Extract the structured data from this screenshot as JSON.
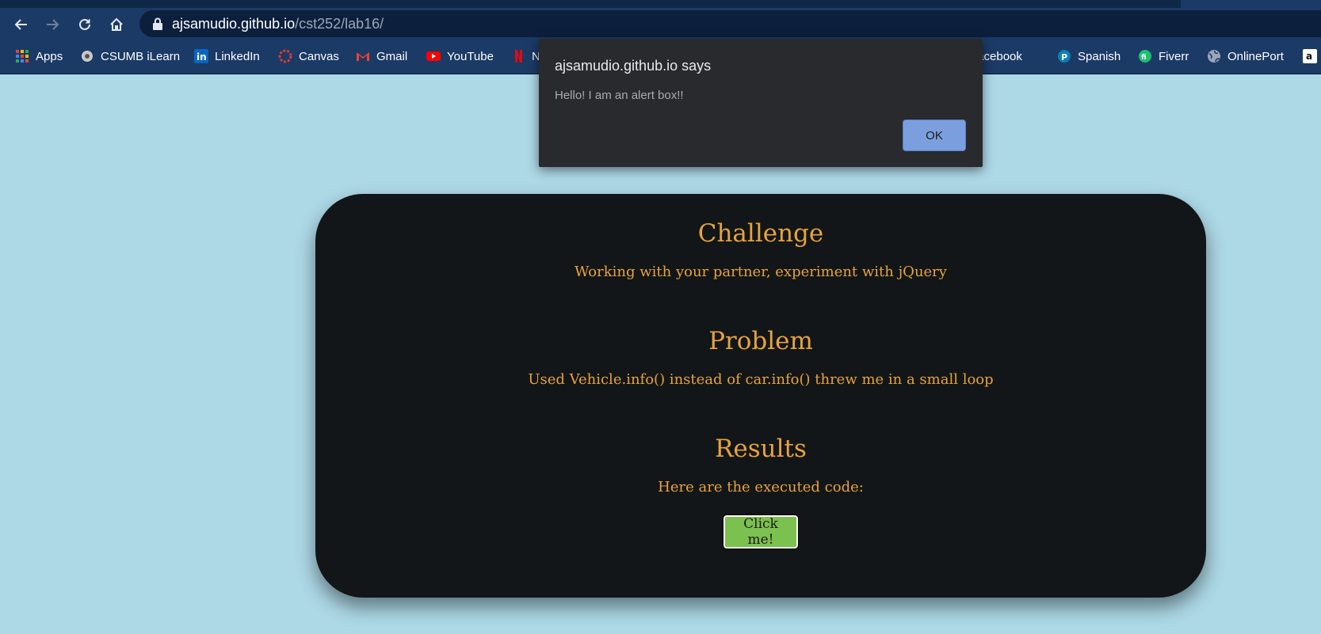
{
  "browser": {
    "url_host": "ajsamudio.github.io",
    "url_path": "/cst252/lab16/",
    "bookmarks": [
      {
        "label": "Apps",
        "icon": "apps-grid-icon"
      },
      {
        "label": "CSUMB iLearn",
        "icon": "ilearn-icon"
      },
      {
        "label": "LinkedIn",
        "icon": "linkedin-icon"
      },
      {
        "label": "Canvas",
        "icon": "canvas-icon"
      },
      {
        "label": "Gmail",
        "icon": "gmail-icon"
      },
      {
        "label": "YouTube",
        "icon": "youtube-icon"
      },
      {
        "label": "N",
        "icon": "netflix-icon"
      },
      {
        "label": "Facebook",
        "icon": "facebook-icon"
      },
      {
        "label": "Spanish",
        "icon": "pearson-icon"
      },
      {
        "label": "Fiverr",
        "icon": "fiverr-icon"
      },
      {
        "label": "OnlinePort",
        "icon": "globe-icon"
      },
      {
        "label": "",
        "icon": "amazon-icon"
      }
    ]
  },
  "alert": {
    "title": "ajsamudio.github.io says",
    "message": "Hello! I am an alert box!!",
    "ok_label": "OK"
  },
  "card": {
    "challenge_title": "Challenge",
    "challenge_text": "Working with your partner, experiment with jQuery",
    "problem_title": "Problem",
    "problem_text": "Used Vehicle.info() instead of  car.info() threw me in a small loop",
    "results_title": "Results",
    "results_text": "Here are the executed code:",
    "button_label": "Click me!"
  },
  "colors": {
    "page_bg": "#add8e6",
    "card_bg": "#121618",
    "accent_text": "#e8a33a",
    "button_bg": "#7cc04f",
    "alert_bg": "#292a2d",
    "ok_bg": "#7b9fde"
  }
}
